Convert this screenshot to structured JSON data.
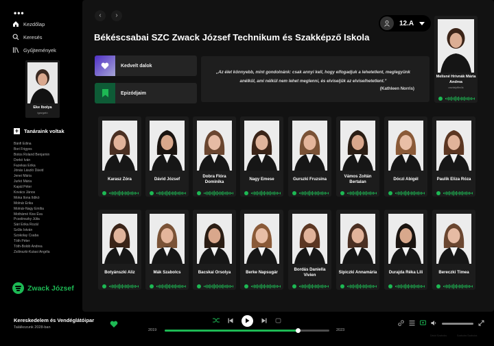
{
  "sidebar": {
    "menu_dots": "•••",
    "nav": [
      {
        "label": "Kezdőlap",
        "icon": "home-icon"
      },
      {
        "label": "Keresés",
        "icon": "search-icon"
      },
      {
        "label": "Gyűjtemények",
        "icon": "library-icon"
      }
    ],
    "teacher": {
      "name": "Eke Ibolya",
      "role": "igazgató"
    },
    "section_title": "Tanáraink voltak",
    "teachers": [
      "Bánfi Edina",
      "Bori Frigyes",
      "Botos Roland Benjamin",
      "Dorkó Iván",
      "Fazekas Erika",
      "Jónás László Dávid",
      "Jenei Mária",
      "Jurkó Mária",
      "Kapál Péter",
      "Kovács János",
      "Moka Ilona Ildikó",
      "Molnár Erika",
      "Molnár-Nagy Emília",
      "Mothárné Kiss Éva",
      "Pcsolinszky Júlia",
      "Sári Erika Rozál",
      "Szűts István",
      "Szokolay Csaba",
      "Tóth Péter",
      "Tóth-Boldó Andrea",
      "Zsilinszki-Kutasi Angéla"
    ],
    "brand": "Zwack József"
  },
  "header": {
    "class_label": "12.A",
    "school_title": "Békéscsabai SZC Zwack József Technikum és Szakképző Iskola"
  },
  "shortcuts": [
    {
      "label": "Kedvelt dalok",
      "icon": "heart-icon"
    },
    {
      "label": "Epizódjaim",
      "icon": "bookmark-icon"
    }
  ],
  "quote": {
    "text": "„Az élet könnyebb, mint gondolnánk: csak annyi kell, hogy elfogadjuk a lehetetlent, meglegyünk anélkül, ami nélkül nem lehet meglenni, és elviseljük az elviselhetetlent.”",
    "author": "(Kathleen Norris)"
  },
  "head_teacher": {
    "name": "Melisné Hrivnák Mária Andrea",
    "role": "osztályfőnök"
  },
  "students_row1": [
    "Karasz Zóra",
    "Dávid József",
    "Dobra Flóra Dominika",
    "Nagy Emese",
    "Gurszki Fruzsina",
    "Vámos Zoltán Bertalan",
    "Dóczi Abigél",
    "Paulik Eliza Róza"
  ],
  "students_row2": [
    "Botyánszki Aliz",
    "Mák Szabolcs",
    "Bacskai Orsolya",
    "Berke Napsugár",
    "Bordás Daniella Vivien",
    "Sipiczki Annamária",
    "Durajda Réka Lili",
    "Bereczki Tímea"
  ],
  "player": {
    "track_title": "Kereskedelem és Vendéglátóipar",
    "track_sub": "Találkozunk 2028-ban",
    "year_start": "2019",
    "year_end": "2023",
    "progress": 0.81,
    "credit_left": "Dávid Szabolcs",
    "credit_right": "Szabolcs Szabolcs"
  },
  "colors": {
    "accent": "#1db954",
    "background": "#121212",
    "card": "#1c1c1c",
    "liked_from": "#4f2fc6",
    "liked_to": "#a6a6d6",
    "episodes": "#0e5b36"
  }
}
